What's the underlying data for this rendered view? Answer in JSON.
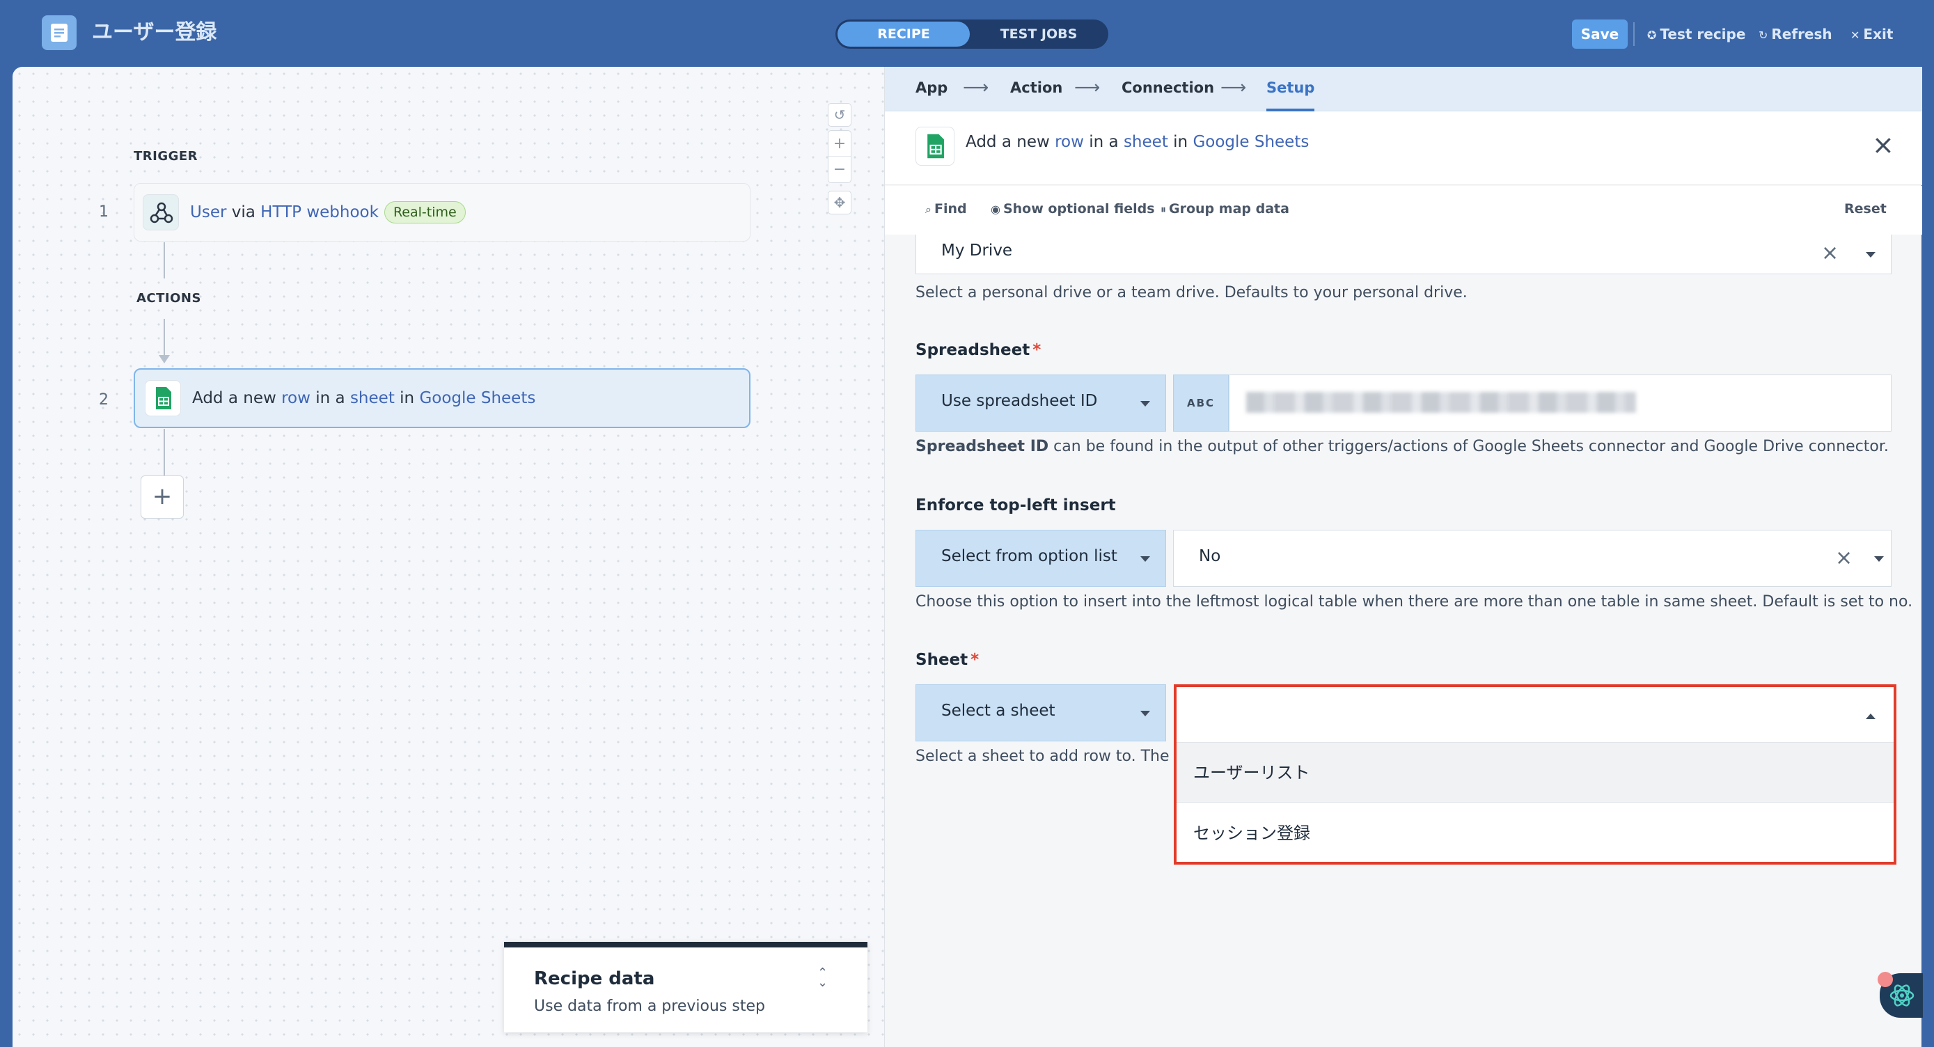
{
  "header": {
    "title": "ユーザー登録",
    "tabs": [
      "RECIPE",
      "TEST JOBS"
    ],
    "save_label": "Save",
    "test_recipe_label": "Test recipe",
    "refresh_label": "Refresh",
    "exit_label": "Exit"
  },
  "canvas": {
    "trigger_label": "TRIGGER",
    "actions_label": "ACTIONS",
    "steps": [
      {
        "number": "1",
        "parts": [
          "User",
          " via ",
          "HTTP webhook"
        ],
        "badge": "Real-time",
        "icon": "webhook-icon"
      },
      {
        "number": "2",
        "parts": [
          "Add a new ",
          "row",
          " in a ",
          "sheet",
          " in ",
          "Google Sheets"
        ],
        "icon": "google-sheets-icon"
      }
    ],
    "add_step_label": "+",
    "recipe_data": {
      "title": "Recipe data",
      "subtitle": "Use data from a previous step"
    }
  },
  "panel": {
    "breadcrumbs": [
      "App",
      "Action",
      "Connection",
      "Setup"
    ],
    "breadcrumb_arrow": "⟶",
    "active_breadcrumb": "Setup",
    "action_title_parts": [
      "Add a new ",
      "row",
      " in a ",
      "sheet",
      " in ",
      "Google Sheets"
    ],
    "close_label": "×",
    "toolbar": {
      "find": "Find",
      "optional": "Show optional fields",
      "group": "Group map data",
      "reset": "Reset"
    },
    "drive": {
      "value": "My Drive",
      "hint": "Select a personal drive or a team drive. Defaults to your personal drive."
    },
    "spreadsheet": {
      "label": "Spreadsheet",
      "required_mark": "*",
      "mode": "Use spreadsheet ID",
      "type_tag": "ABC",
      "hint_bold": "Spreadsheet ID",
      "hint_rest": " can be found in the output of other triggers/actions of Google Sheets connector and Google Drive connector."
    },
    "enforce": {
      "label": "Enforce top-left insert",
      "mode": "Select from option list",
      "value": "No",
      "hint": "Choose this option to insert into the leftmost logical table when there are more than one table in same sheet. Default is set to no."
    },
    "sheet": {
      "label": "Sheet",
      "required_mark": "*",
      "mode": "Select a sheet",
      "hint": "Select a sheet to add row to. The sh",
      "options": [
        "ユーザーリスト",
        "セッション登録"
      ]
    }
  },
  "colors": {
    "brand": "#3a66a8",
    "accent": "#5b9ee8",
    "link": "#3f66b5",
    "highlight_border": "#e23b2a"
  }
}
